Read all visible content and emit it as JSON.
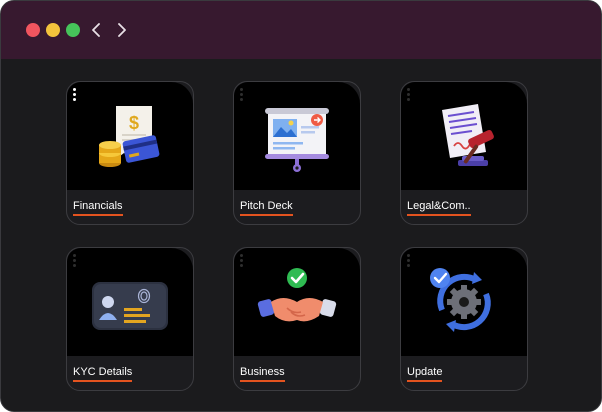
{
  "window": {
    "traffic_lights": [
      "#f1555f",
      "#f3c33c",
      "#46c45a"
    ],
    "nav": {
      "back_icon": "chevron-left-icon",
      "forward_icon": "chevron-right-icon"
    }
  },
  "cards": [
    {
      "label": "Financials",
      "icon": "money-receipt-icon"
    },
    {
      "label": "Pitch Deck",
      "icon": "presentation-board-icon"
    },
    {
      "label": "Legal&Com..",
      "icon": "gavel-document-icon"
    },
    {
      "label": "KYC Details",
      "icon": "id-card-icon"
    },
    {
      "label": "Business",
      "icon": "handshake-icon"
    },
    {
      "label": "Update",
      "icon": "sync-gear-icon"
    }
  ],
  "colors": {
    "accent_underline": "#e3531f",
    "titlebar": "#37192f",
    "background": "#1b1b1d"
  }
}
